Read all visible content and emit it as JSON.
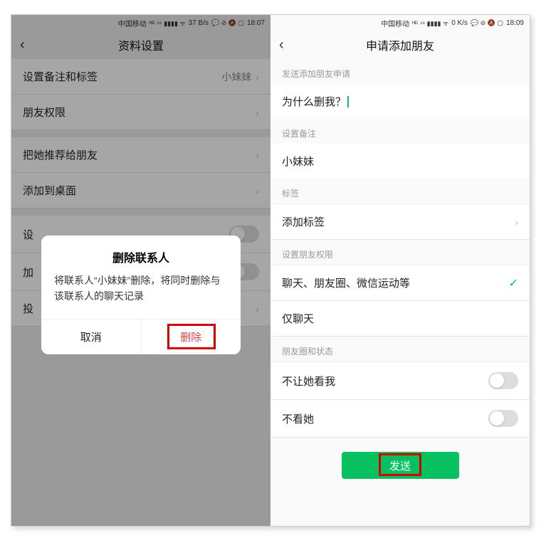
{
  "left": {
    "statusbar": {
      "carrier": "中国移动",
      "time": "18:07",
      "net": "37 B/s"
    },
    "navbar": {
      "title": "资料设置"
    },
    "rows": {
      "remark_label": "设置备注和标签",
      "remark_value": "小妹妹",
      "perm": "朋友权限",
      "recommend": "把她推荐给朋友",
      "desktop": "添加到桌面",
      "star_prefix": "设",
      "block_prefix": "加",
      "complain_prefix": "投"
    },
    "delete_row": "删除",
    "modal": {
      "title": "删除联系人",
      "msg": "将联系人“小妹妹”删除，将同时删除与该联系人的聊天记录",
      "cancel": "取消",
      "confirm": "删除"
    }
  },
  "right": {
    "statusbar": {
      "carrier": "中国移动",
      "time": "18:09",
      "net": "0 K/s"
    },
    "navbar": {
      "title": "申请添加朋友"
    },
    "sections": {
      "apply_label": "发送添加朋友申请",
      "apply_value": "为什么删我？",
      "remark_label": "设置备注",
      "remark_value": "小妹妹",
      "tag_label": "标签",
      "tag_value": "添加标签",
      "perm_label": "设置朋友权限",
      "perm_opt1": "聊天、朋友圈、微信运动等",
      "perm_opt2": "仅聊天",
      "moments_label": "朋友圈和状态",
      "hide_me": "不让她看我",
      "hide_her": "不看她"
    },
    "send_btn": "发送"
  }
}
